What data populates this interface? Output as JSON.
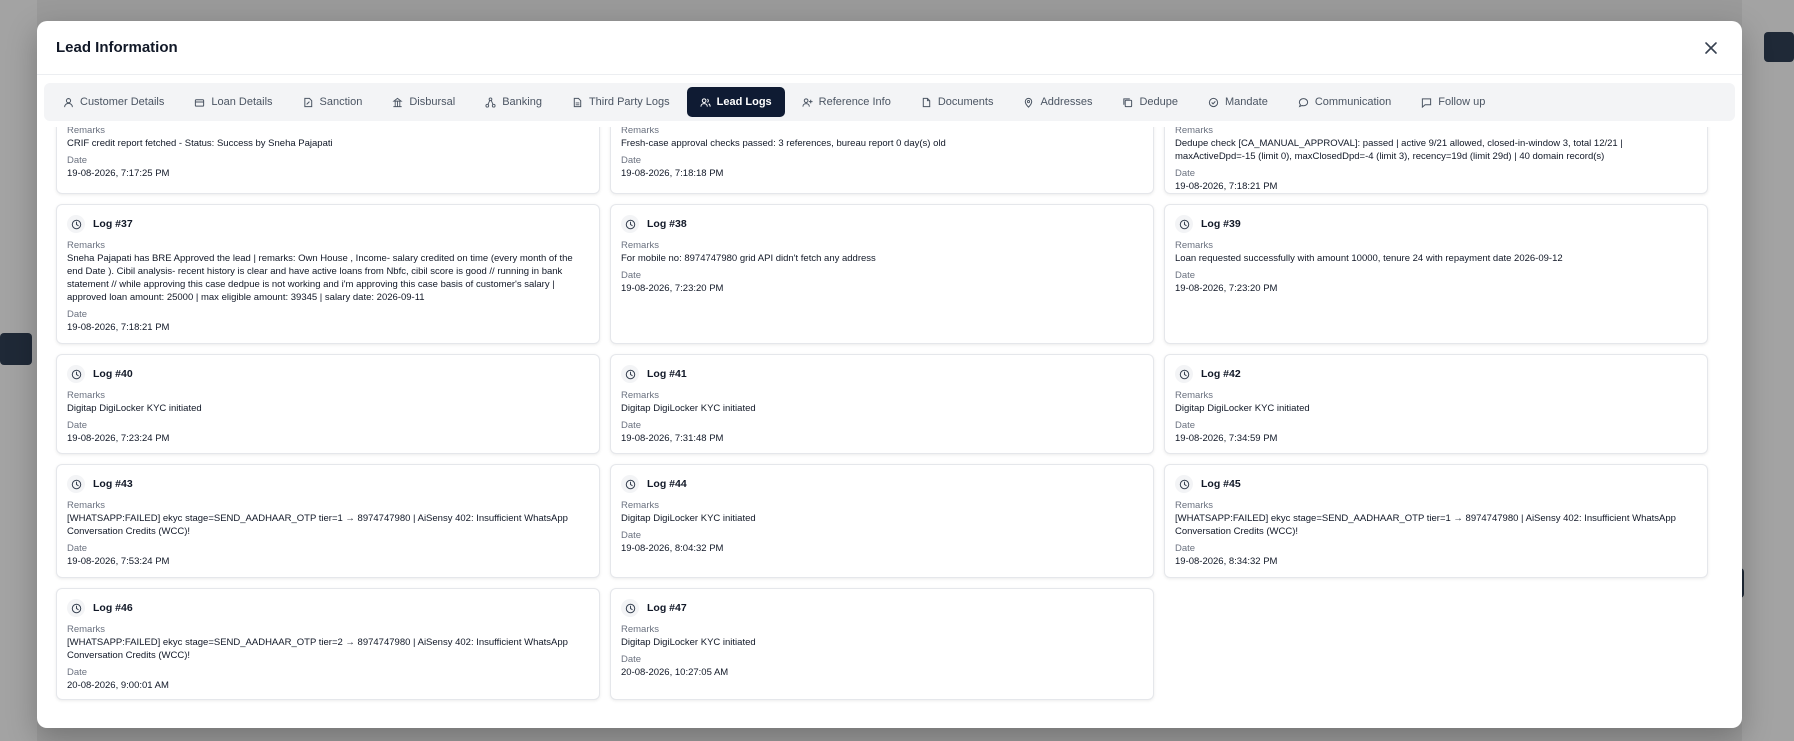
{
  "modal": {
    "title": "Lead Information"
  },
  "tabs": [
    {
      "label": "Customer Details",
      "icon": "user-icon",
      "active": false
    },
    {
      "label": "Loan Details",
      "icon": "bank-card-icon",
      "active": false
    },
    {
      "label": "Sanction",
      "icon": "edit-document-icon",
      "active": false
    },
    {
      "label": "Disbursal",
      "icon": "building-icon",
      "active": false
    },
    {
      "label": "Banking",
      "icon": "network-icon",
      "active": false
    },
    {
      "label": "Third Party Logs",
      "icon": "file-icon",
      "active": false
    },
    {
      "label": "Lead Logs",
      "icon": "users-icon",
      "active": true
    },
    {
      "label": "Reference Info",
      "icon": "user-plus-icon",
      "active": false
    },
    {
      "label": "Documents",
      "icon": "document-icon",
      "active": false
    },
    {
      "label": "Addresses",
      "icon": "map-pin-icon",
      "active": false
    },
    {
      "label": "Dedupe",
      "icon": "copy-icon",
      "active": false
    },
    {
      "label": "Mandate",
      "icon": "check-circle-icon",
      "active": false
    },
    {
      "label": "Communication",
      "icon": "chat-bubble-icon",
      "active": false
    },
    {
      "label": "Follow up",
      "icon": "message-square-icon",
      "active": false
    }
  ],
  "labels": {
    "remarks": "Remarks",
    "date": "Date"
  },
  "partial_logs": [
    {
      "remarks": "CRIF credit report fetched - Status: Success by Sneha Pajapati",
      "date": "19-08-2026, 7:17:25 PM"
    },
    {
      "remarks": "Fresh-case approval checks passed: 3 references, bureau report 0 day(s) old",
      "date": "19-08-2026, 7:18:18 PM"
    },
    {
      "remarks": "Dedupe check [CA_MANUAL_APPROVAL]: passed | active 9/21 allowed, closed-in-window 3, total 12/21 | maxActiveDpd=-15 (limit 0), maxClosedDpd=-4 (limit 3), recency=19d (limit 29d) | 40 domain record(s)",
      "date": "19-08-2026, 7:18:21 PM"
    }
  ],
  "logs": [
    {
      "title": "Log #37",
      "remarks": "Sneha Pajapati has BRE Approved the lead | remarks: Own House , Income- salary credited on time (every month of the end Date ). Cibil analysis- recent history is clear and have active loans from Nbfc, cibil score is good // running in bank statement // while approving this case dedpue is not working and i'm approving this case basis of customer's salary | approved loan amount: 25000 | max eligible amount: 39345 | salary date: 2026-09-11",
      "date": "19-08-2026, 7:18:21 PM"
    },
    {
      "title": "Log #38",
      "remarks": "For mobile no: 8974747980 grid API didn't fetch any address",
      "date": "19-08-2026, 7:23:20 PM"
    },
    {
      "title": "Log #39",
      "remarks": "Loan requested successfully with amount 10000, tenure 24 with repayment date 2026-09-12",
      "date": "19-08-2026, 7:23:20 PM"
    },
    {
      "title": "Log #40",
      "remarks": "Digitap DigiLocker KYC initiated",
      "date": "19-08-2026, 7:23:24 PM"
    },
    {
      "title": "Log #41",
      "remarks": "Digitap DigiLocker KYC initiated",
      "date": "19-08-2026, 7:31:48 PM"
    },
    {
      "title": "Log #42",
      "remarks": "Digitap DigiLocker KYC initiated",
      "date": "19-08-2026, 7:34:59 PM"
    },
    {
      "title": "Log #43",
      "remarks": "[WHATSAPP:FAILED] ekyc stage=SEND_AADHAAR_OTP tier=1 → 8974747980 | AiSensy 402: Insufficient WhatsApp Conversation Credits (WCC)!",
      "date": "19-08-2026, 7:53:24 PM"
    },
    {
      "title": "Log #44",
      "remarks": "Digitap DigiLocker KYC initiated",
      "date": "19-08-2026, 8:04:32 PM"
    },
    {
      "title": "Log #45",
      "remarks": "[WHATSAPP:FAILED] ekyc stage=SEND_AADHAAR_OTP tier=1 → 8974747980 | AiSensy 402: Insufficient WhatsApp Conversation Credits (WCC)!",
      "date": "19-08-2026, 8:34:32 PM"
    },
    {
      "title": "Log #46",
      "remarks": "[WHATSAPP:FAILED] ekyc stage=SEND_AADHAAR_OTP tier=2 → 8974747980 | AiSensy 402: Insufficient WhatsApp Conversation Credits (WCC)!",
      "date": "20-08-2026, 9:00:01 AM"
    },
    {
      "title": "Log #47",
      "remarks": "Digitap DigiLocker KYC initiated",
      "date": "20-08-2026, 10:27:05 AM"
    }
  ],
  "colors": {
    "active_tab": "#0f1b33",
    "overlay": "#9a9a9a"
  }
}
